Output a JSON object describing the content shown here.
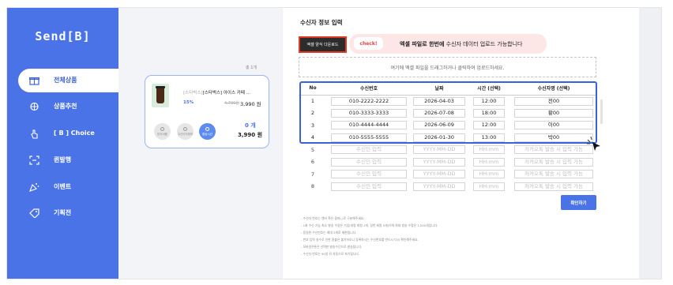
{
  "app": {
    "logo": "Send[B]"
  },
  "sidebar": {
    "items": [
      {
        "label": "전체상품",
        "icon": "gift-icon",
        "active": true
      },
      {
        "label": "상품추천",
        "icon": "gift-ribbon-icon"
      },
      {
        "label": "[ B ] Choice",
        "icon": "hand-pointer-icon"
      },
      {
        "label": "퀸발행",
        "icon": "expand-icon"
      },
      {
        "label": "이벤트",
        "icon": "party-icon"
      },
      {
        "label": "기획전",
        "icon": "tag-icon"
      }
    ]
  },
  "cart": {
    "count_label": "총 1개",
    "product": {
      "brand": "[스타벅스]",
      "name": "[스타벅스] 아이스 카페 ...",
      "discount": "15%",
      "original_price": "4,700원",
      "price": "3,990 원"
    },
    "actions": [
      "받아내용",
      "수신이자정보",
      "발송시간"
    ],
    "quantity": "0 개",
    "total": "3,990 원"
  },
  "form": {
    "title": "수신자 정보 입력",
    "download_label": "엑셀 양식 다운로드",
    "check_label": "check!",
    "notice_bold": "엑셀 파일로 한번에",
    "notice_rest": "수신자 데이터 업로드 가능합니다",
    "drop_text": "여기에 엑셀 파일을 드래그하거나 클릭하여 업로드하세요.",
    "columns": [
      "No",
      "수신번호",
      "날짜",
      "시간 (선택)",
      "수신자명 (선택)"
    ],
    "rows": [
      {
        "no": "1",
        "phone": "010-2222-2222",
        "date": "2026-04-03",
        "time": "12:00",
        "name": "전00"
      },
      {
        "no": "2",
        "phone": "010-3333-3333",
        "date": "2026-07-08",
        "time": "18:00",
        "name": "황00"
      },
      {
        "no": "3",
        "phone": "010-4444-4444",
        "date": "2026-06-09",
        "time": "12:00",
        "name": "이00"
      },
      {
        "no": "4",
        "phone": "010-5555-5555",
        "date": "2026-01-30",
        "time": "13:00",
        "name": "박00"
      }
    ],
    "empty_rows": [
      "5",
      "6",
      "7",
      "8"
    ],
    "placeholders": {
      "phone": "수신인 입력",
      "date": "YYYY-MM-DD",
      "time": "HH:mm",
      "name": "카카오톡 발송 시 입력 가능"
    },
    "confirm_label": "확인하기",
    "notes": [
      "- 수신자 번호는 엔터 혹은 콤마(,)로 구분해주세요.",
      "- 1회 수신 가능 최소 발송 수량은 기업(대량 회원 1개, 일반 회원 5개)이며 최대 발송 수량은 1,000개입니다.",
      "- 동일한 수신번호는 최대 2개로 제한됩니다.",
      "- 번호 입력 실수로 인한 환불은 불가하오니 등록하시는 수신번호를 반드시 다시 확인해주세요.",
      "- 모바일쿠폰은 선택한 발송수단으로 발송됩니다.",
      "- 수신자 번호는 90일 뒤 자동으로 파기됩니다."
    ]
  },
  "colors": {
    "brand": "#4a73e8",
    "highlight": "#3a62d8",
    "alert": "#e23a22"
  }
}
